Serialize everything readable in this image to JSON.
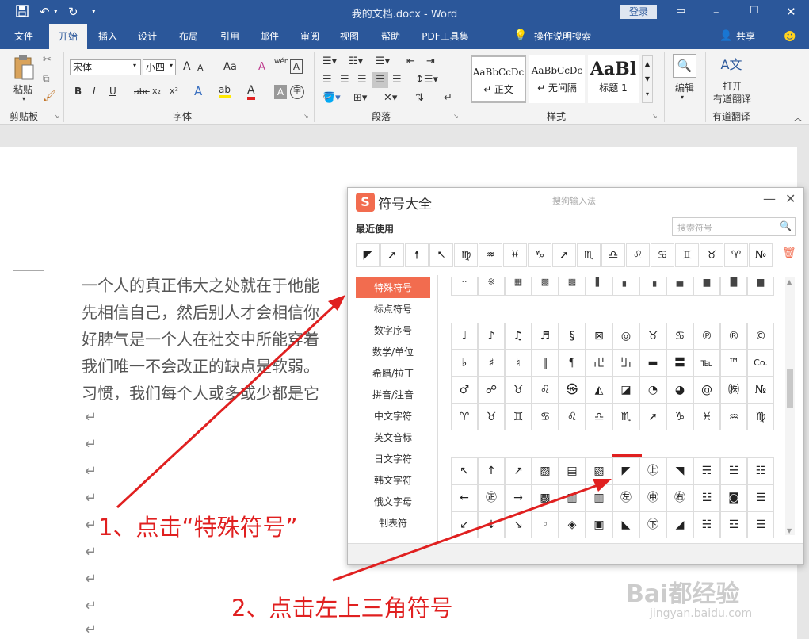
{
  "titlebar": {
    "title": "我的文档.docx  -  Word",
    "login_label": "登录",
    "icons": [
      "save-icon",
      "undo-icon",
      "redo-icon",
      "customize-icon",
      "ribbon-display-icon",
      "minimize-icon",
      "maximize-icon",
      "close-icon"
    ]
  },
  "tabs": {
    "items": [
      "文件",
      "开始",
      "插入",
      "设计",
      "布局",
      "引用",
      "邮件",
      "审阅",
      "视图",
      "帮助",
      "PDF工具集"
    ],
    "active": "开始",
    "tell_me": "操作说明搜索",
    "share": "共享"
  },
  "ribbon": {
    "clipboard": {
      "paste": "粘贴",
      "label": "剪贴板"
    },
    "font": {
      "name": "宋体",
      "size": "小四",
      "label": "字体",
      "row1": [
        "A",
        "A",
        "Aa",
        "A",
        "wén",
        "A"
      ],
      "row2": [
        "B",
        "I",
        "U",
        "abc",
        "x₂",
        "x²",
        "A",
        "ab",
        "A",
        "A",
        "字"
      ]
    },
    "paragraph": {
      "label": "段落"
    },
    "styles": {
      "label": "样式",
      "items": [
        {
          "preview": "AaBbCcDc",
          "name": "↵ 正文"
        },
        {
          "preview": "AaBbCcDc",
          "name": "↵ 无间隔"
        },
        {
          "preview": "AaBl",
          "name": "标题 1"
        }
      ]
    },
    "editing": {
      "label": "编辑"
    },
    "translate": {
      "line1": "打开",
      "line2": "有道翻译",
      "group": "有道翻译"
    }
  },
  "document": {
    "lines": [
      "一个人的真正伟大之处就在于他能",
      "先相信自己，然后别人才会相信你",
      "好脾气是一个人在社交中所能穿着",
      "我们唯一不会改正的缺点是软弱。",
      "习惯，我们每个人或多或少都是它"
    ],
    "return_mark": "↵"
  },
  "symbol_panel": {
    "logo": "S",
    "title": "符号大全",
    "subtitle": "搜狗输入法",
    "search_placeholder": "搜索符号",
    "recent_label": "最近使用",
    "recent": [
      "◤",
      "➚",
      "🠕",
      "⭦",
      "♍",
      "♒",
      "♓",
      "♑",
      "➚",
      "♏",
      "♎",
      "♌",
      "♋",
      "♊",
      "♉",
      "♈",
      "№"
    ],
    "categories": [
      "特殊符号",
      "标点符号",
      "数字序号",
      "数学/单位",
      "希腊/拉丁",
      "拼音/注音",
      "中文字符",
      "英文音标",
      "日文字符",
      "韩文字符",
      "俄文字母",
      "制表符"
    ],
    "active_category": "特殊符号",
    "grid_top": [
      "··",
      "※",
      "▦",
      "▩",
      "▩",
      "▌",
      "▖",
      "▗",
      "▄",
      "▆",
      "█",
      "▆"
    ],
    "grid_mid": [
      [
        "♩",
        "♪",
        "♫",
        "♬",
        "§",
        "⊠",
        "◎",
        "♉",
        "♋",
        "℗",
        "®",
        "©"
      ],
      [
        "♭",
        "♯",
        "♮",
        "‖",
        "¶",
        "卍",
        "卐",
        "▬",
        "〓",
        "℡",
        "™",
        "Co."
      ],
      [
        "♂",
        "☍",
        "♉",
        "♌",
        "㉿",
        "◭",
        "◪",
        "◔",
        "◕",
        "@",
        "㈱",
        "№"
      ],
      [
        "♈",
        "♉",
        "♊",
        "♋",
        "♌",
        "♎",
        "♏",
        "➚",
        "♑",
        "♓",
        "♒",
        "♍"
      ]
    ],
    "grid_bot": [
      [
        "↖",
        "↑",
        "↗",
        "▨",
        "▤",
        "▧",
        "◤",
        "㊤",
        "◥",
        "☴",
        "☱",
        "☷"
      ],
      [
        "←",
        "㊣",
        "→",
        "▩",
        "▥",
        "▥",
        "㊧",
        "㊥",
        "㊨",
        "☳",
        "◙",
        "☰"
      ],
      [
        "↙",
        "↓",
        "↘",
        "◦",
        "◈",
        "▣",
        "◣",
        "㊦",
        "◢",
        "☵",
        "☲",
        "☰"
      ]
    ]
  },
  "annotations": {
    "step1": "1、点击“特殊符号”",
    "step2": "2、点击左上三角符号"
  },
  "watermark": {
    "brand": "Bai都经验",
    "url": "jingyan.baidu.com"
  },
  "colors": {
    "word_blue": "#2b579a",
    "sogou_orange": "#f26c4f",
    "annotation_red": "#e02020"
  }
}
